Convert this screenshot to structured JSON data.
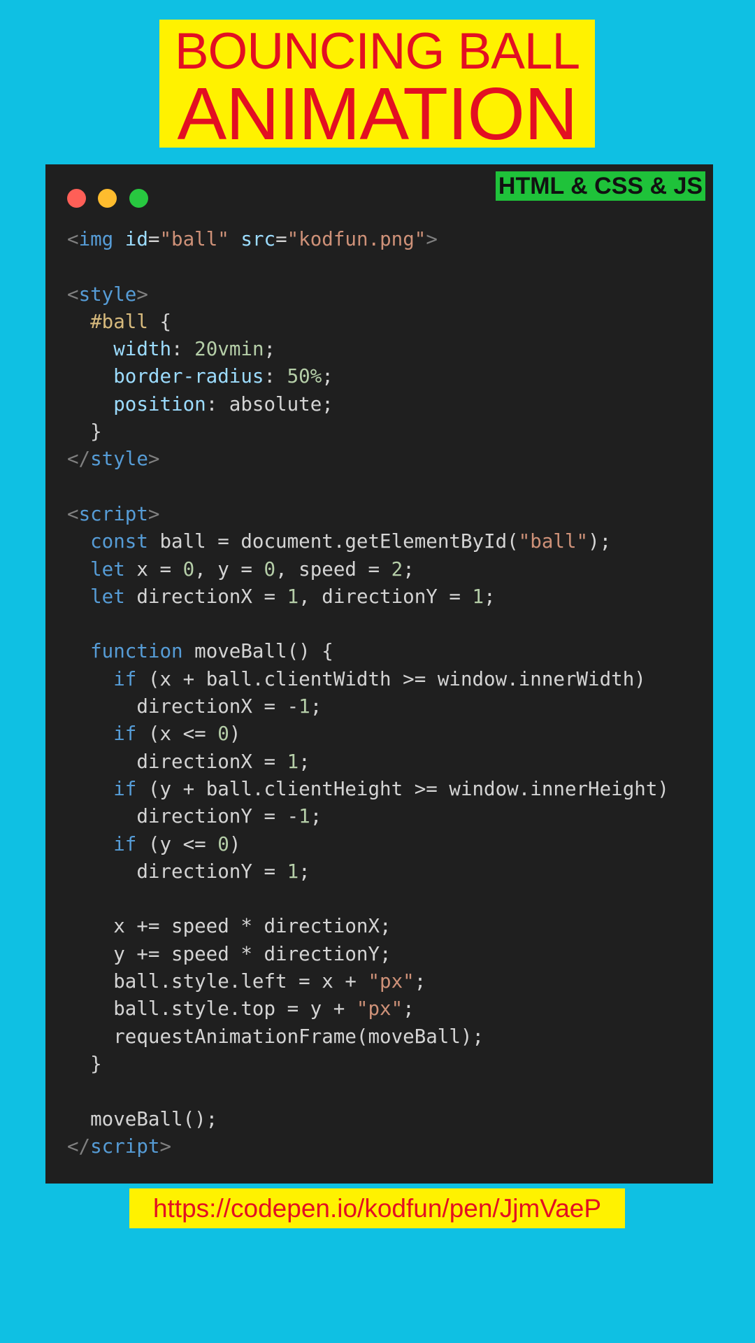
{
  "title": {
    "line1": "BOUNCING BALL",
    "line2": "ANIMATION",
    "text_color": "#e30f22",
    "box_color": "#fff200"
  },
  "code_window": {
    "window_controls": [
      "close-dot",
      "minimize-dot",
      "maximize-dot"
    ],
    "language_badge": "HTML & CSS & JS",
    "badge_color": "#1fc23a",
    "lines": [
      [
        [
          "punct",
          "<"
        ],
        [
          "tag",
          "img"
        ],
        [
          "plain",
          " "
        ],
        [
          "attr",
          "id"
        ],
        [
          "plain",
          "="
        ],
        [
          "str",
          "\"ball\""
        ],
        [
          "plain",
          " "
        ],
        [
          "attr",
          "src"
        ],
        [
          "plain",
          "="
        ],
        [
          "str",
          "\"kodfun.png\""
        ],
        [
          "punct",
          ">"
        ]
      ],
      [],
      [
        [
          "punct",
          "<"
        ],
        [
          "tag",
          "style"
        ],
        [
          "punct",
          ">"
        ]
      ],
      [
        [
          "plain",
          "  "
        ],
        [
          "sel",
          "#ball"
        ],
        [
          "plain",
          " {"
        ]
      ],
      [
        [
          "plain",
          "    "
        ],
        [
          "prop",
          "width"
        ],
        [
          "plain",
          ": "
        ],
        [
          "num",
          "20vmin"
        ],
        [
          "plain",
          ";"
        ]
      ],
      [
        [
          "plain",
          "    "
        ],
        [
          "prop",
          "border-radius"
        ],
        [
          "plain",
          ": "
        ],
        [
          "num",
          "50%"
        ],
        [
          "plain",
          ";"
        ]
      ],
      [
        [
          "plain",
          "    "
        ],
        [
          "prop",
          "position"
        ],
        [
          "plain",
          ": absolute;"
        ]
      ],
      [
        [
          "plain",
          "  }"
        ]
      ],
      [
        [
          "punct",
          "</"
        ],
        [
          "tag",
          "style"
        ],
        [
          "punct",
          ">"
        ]
      ],
      [],
      [
        [
          "punct",
          "<"
        ],
        [
          "tag",
          "script"
        ],
        [
          "punct",
          ">"
        ]
      ],
      [
        [
          "plain",
          "  "
        ],
        [
          "kw",
          "const"
        ],
        [
          "plain",
          " ball = document.getElementById("
        ],
        [
          "str",
          "\"ball\""
        ],
        [
          "plain",
          ");"
        ]
      ],
      [
        [
          "plain",
          "  "
        ],
        [
          "kw",
          "let"
        ],
        [
          "plain",
          " x = "
        ],
        [
          "num",
          "0"
        ],
        [
          "plain",
          ", y = "
        ],
        [
          "num",
          "0"
        ],
        [
          "plain",
          ", speed = "
        ],
        [
          "num",
          "2"
        ],
        [
          "plain",
          ";"
        ]
      ],
      [
        [
          "plain",
          "  "
        ],
        [
          "kw",
          "let"
        ],
        [
          "plain",
          " directionX = "
        ],
        [
          "num",
          "1"
        ],
        [
          "plain",
          ", directionY = "
        ],
        [
          "num",
          "1"
        ],
        [
          "plain",
          ";"
        ]
      ],
      [],
      [
        [
          "plain",
          "  "
        ],
        [
          "kw",
          "function"
        ],
        [
          "plain",
          " moveBall() {"
        ]
      ],
      [
        [
          "plain",
          "    "
        ],
        [
          "kw",
          "if"
        ],
        [
          "plain",
          " (x + ball.clientWidth >= window.innerWidth)"
        ]
      ],
      [
        [
          "plain",
          "      directionX = -"
        ],
        [
          "num",
          "1"
        ],
        [
          "plain",
          ";"
        ]
      ],
      [
        [
          "plain",
          "    "
        ],
        [
          "kw",
          "if"
        ],
        [
          "plain",
          " (x <= "
        ],
        [
          "num",
          "0"
        ],
        [
          "plain",
          ")"
        ]
      ],
      [
        [
          "plain",
          "      directionX = "
        ],
        [
          "num",
          "1"
        ],
        [
          "plain",
          ";"
        ]
      ],
      [
        [
          "plain",
          "    "
        ],
        [
          "kw",
          "if"
        ],
        [
          "plain",
          " (y + ball.clientHeight >= window.innerHeight)"
        ]
      ],
      [
        [
          "plain",
          "      directionY = -"
        ],
        [
          "num",
          "1"
        ],
        [
          "plain",
          ";"
        ]
      ],
      [
        [
          "plain",
          "    "
        ],
        [
          "kw",
          "if"
        ],
        [
          "plain",
          " (y <= "
        ],
        [
          "num",
          "0"
        ],
        [
          "plain",
          ")"
        ]
      ],
      [
        [
          "plain",
          "      directionY = "
        ],
        [
          "num",
          "1"
        ],
        [
          "plain",
          ";"
        ]
      ],
      [],
      [
        [
          "plain",
          "    x += speed * directionX;"
        ]
      ],
      [
        [
          "plain",
          "    y += speed * directionY;"
        ]
      ],
      [
        [
          "plain",
          "    ball.style.left = x + "
        ],
        [
          "str",
          "\"px\""
        ],
        [
          "plain",
          ";"
        ]
      ],
      [
        [
          "plain",
          "    ball.style.top = y + "
        ],
        [
          "str",
          "\"px\""
        ],
        [
          "plain",
          ";"
        ]
      ],
      [
        [
          "plain",
          "    requestAnimationFrame(moveBall);"
        ]
      ],
      [
        [
          "plain",
          "  }"
        ]
      ],
      [],
      [
        [
          "plain",
          "  moveBall();"
        ]
      ],
      [
        [
          "punct",
          "</"
        ],
        [
          "tag",
          "script"
        ],
        [
          "punct",
          ">"
        ]
      ]
    ]
  },
  "footer": {
    "url": "https://codepen.io/kodfun/pen/JjmVaeP"
  }
}
